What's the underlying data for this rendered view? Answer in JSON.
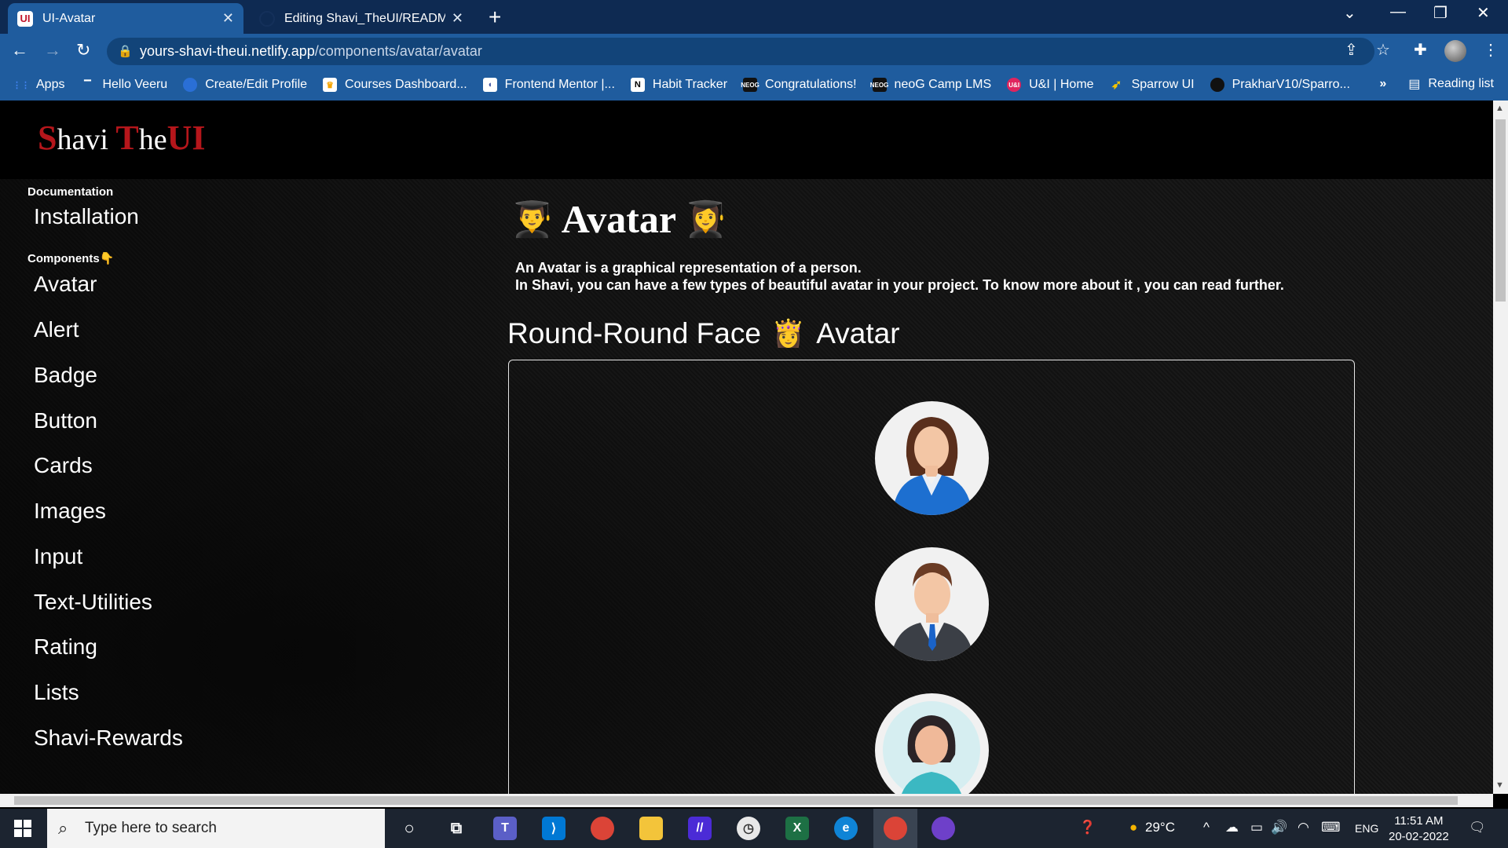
{
  "browser": {
    "tabs": [
      {
        "title": "UI-Avatar",
        "favicon": "UI",
        "active": true
      },
      {
        "title": "Editing Shavi_TheUI/README.md",
        "favicon": "github-icon",
        "active": false
      }
    ],
    "url_host": "yours-shavi-theui.netlify.app",
    "url_path": "/components/avatar/avatar",
    "bookmarks": [
      {
        "label": "Apps",
        "icon": "apps-grid-icon",
        "color": "#4285f4"
      },
      {
        "label": "Hello Veeru",
        "icon": "bookmark-icon",
        "color": "#222"
      },
      {
        "label": "Create/Edit Profile",
        "icon": "globe-icon",
        "color": "#2a6fd6"
      },
      {
        "label": "Courses Dashboard...",
        "icon": "crown-icon",
        "color": "#f5c400"
      },
      {
        "label": "Frontend Mentor |...",
        "icon": "fm-icon",
        "color": "#ffffff"
      },
      {
        "label": "Habit Tracker",
        "icon": "notion-icon",
        "color": "#ffffff"
      },
      {
        "label": "Congratulations!",
        "icon": "neog-icon",
        "color": "#111"
      },
      {
        "label": "neoG Camp LMS",
        "icon": "neog-icon",
        "color": "#111"
      },
      {
        "label": "U&I | Home",
        "icon": "ui-icon",
        "color": "#e0245e"
      },
      {
        "label": "Sparrow UI",
        "icon": "sparrow-icon",
        "color": "#f5c400"
      },
      {
        "label": "PrakharV10/Sparro...",
        "icon": "github-icon",
        "color": "#111"
      }
    ],
    "reading_list": "Reading list",
    "more_bookmarks": "»"
  },
  "site": {
    "logo_parts": [
      "S",
      "havi ",
      "T",
      "he",
      "UI"
    ],
    "sidebar": {
      "doc_heading": "Documentation",
      "doc_items": [
        "Installation"
      ],
      "comp_heading": "Components👇",
      "comp_items": [
        "Avatar",
        "Alert",
        "Badge",
        "Button",
        "Cards",
        "Images",
        "Input",
        "Text-Utilities",
        "Rating",
        "Lists",
        "Shavi-Rewards"
      ]
    },
    "main": {
      "title": "Avatar",
      "title_emoji_left": "👨‍🎓",
      "title_emoji_right": "👩‍🎓",
      "desc_line1": "An Avatar is a graphical representation of a person.",
      "desc_line2": "In Shavi, you can have a few types of beautiful avatar in your project. To know more about it , you can read further.",
      "section_title_a": "Round-Round Face",
      "section_emoji": "👸",
      "section_title_b": "Avatar",
      "avatars": [
        "businesswoman-avatar",
        "businessman-avatar",
        "woman-avatar"
      ]
    }
  },
  "taskbar": {
    "search_placeholder": "Type here to search",
    "weather": "29°C",
    "lang": "ENG",
    "time": "11:51 AM",
    "date": "20-02-2022"
  }
}
